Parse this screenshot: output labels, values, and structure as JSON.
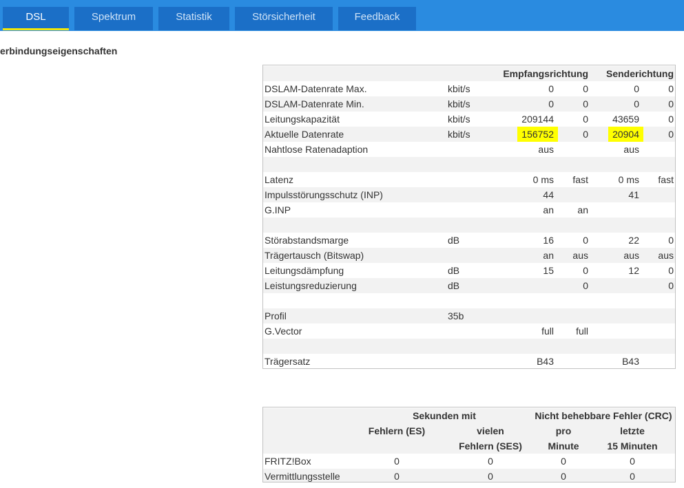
{
  "tabs": [
    {
      "label": "DSL"
    },
    {
      "label": "Spektrum"
    },
    {
      "label": "Statistik"
    },
    {
      "label": "Störsicherheit"
    },
    {
      "label": "Feedback"
    }
  ],
  "colors": {
    "topbar": "#2a8be0",
    "tab": "#1b6fc7",
    "active_underline": "#f2e70a",
    "highlight": "#ffff00"
  },
  "section_title": "erbindungseigenschaften",
  "props_table": {
    "header": {
      "empfang": "Empfangsrichtung",
      "sende": "Senderichtung"
    },
    "rows": [
      {
        "label": "DSLAM-Datenrate Max.",
        "unit": "kbit/s",
        "e1": "0",
        "e2": "0",
        "s1": "0",
        "s2": "0"
      },
      {
        "label": "DSLAM-Datenrate Min.",
        "unit": "kbit/s",
        "e1": "0",
        "e2": "0",
        "s1": "0",
        "s2": "0"
      },
      {
        "label": "Leitungskapazität",
        "unit": "kbit/s",
        "e1": "209144",
        "e2": "0",
        "s1": "43659",
        "s2": "0"
      },
      {
        "label": "Aktuelle Datenrate",
        "unit": "kbit/s",
        "e1": "156752",
        "e2": "0",
        "s1": "20904",
        "s2": "0"
      },
      {
        "label": "Nahtlose Ratenadaption",
        "unit": "",
        "e1": "aus",
        "e2": "",
        "s1": "aus",
        "s2": ""
      },
      {
        "label": "",
        "unit": "",
        "e1": "",
        "e2": "",
        "s1": "",
        "s2": ""
      },
      {
        "label": "Latenz",
        "unit": "",
        "e1": "0 ms",
        "e2": "fast",
        "s1": "0 ms",
        "s2": "fast"
      },
      {
        "label": "Impulsstörungsschutz (INP)",
        "unit": "",
        "e1": "44",
        "e2": "",
        "s1": "41",
        "s2": ""
      },
      {
        "label": "G.INP",
        "unit": "",
        "e1": "an",
        "e2": "an",
        "s1": "",
        "s2": ""
      },
      {
        "label": "",
        "unit": "",
        "e1": "",
        "e2": "",
        "s1": "",
        "s2": ""
      },
      {
        "label": "Störabstandsmarge",
        "unit": "dB",
        "e1": "16",
        "e2": "0",
        "s1": "22",
        "s2": "0"
      },
      {
        "label": "Trägertausch (Bitswap)",
        "unit": "",
        "e1": "an",
        "e2": "aus",
        "s1": "aus",
        "s2": "aus"
      },
      {
        "label": "Leitungsdämpfung",
        "unit": "dB",
        "e1": "15",
        "e2": "0",
        "s1": "12",
        "s2": "0"
      },
      {
        "label": "Leistungsreduzierung",
        "unit": "dB",
        "e1": "",
        "e2": "0",
        "s1": "",
        "s2": "0"
      },
      {
        "label": "",
        "unit": "",
        "e1": "",
        "e2": "",
        "s1": "",
        "s2": ""
      },
      {
        "label": "Profil",
        "unit": "35b",
        "e1": "",
        "e2": "",
        "s1": "",
        "s2": ""
      },
      {
        "label": "G.Vector",
        "unit": "",
        "e1": "full",
        "e2": "full",
        "s1": "",
        "s2": ""
      },
      {
        "label": "",
        "unit": "",
        "e1": "",
        "e2": "",
        "s1": "",
        "s2": ""
      },
      {
        "label": "Trägersatz",
        "unit": "",
        "e1": "B43",
        "e2": "",
        "s1": "B43",
        "s2": ""
      }
    ]
  },
  "errors_table": {
    "header1": {
      "sek": "Sekunden mit",
      "crc": "Nicht behebbare Fehler (CRC)"
    },
    "header2": {
      "es": "Fehlern (ES)",
      "ses_a": "vielen",
      "pro": "pro",
      "letzte": "letzte"
    },
    "header3": {
      "ses_b": "Fehlern (SES)",
      "minute": "Minute",
      "min15": "15 Minuten"
    },
    "rows": [
      {
        "label": "FRITZ!Box",
        "es": "0",
        "ses": "0",
        "pro": "0",
        "letzte": "0"
      },
      {
        "label": "Vermittlungsstelle",
        "es": "0",
        "ses": "0",
        "pro": "0",
        "letzte": "0"
      }
    ]
  }
}
